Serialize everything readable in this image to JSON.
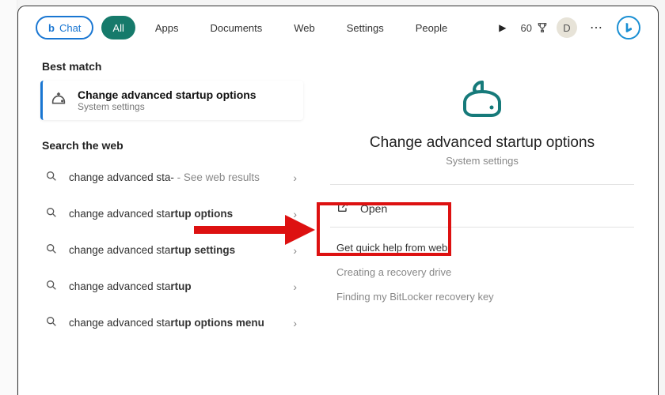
{
  "tabs": {
    "chat": "Chat",
    "all": "All",
    "apps": "Apps",
    "documents": "Documents",
    "web": "Web",
    "settings": "Settings",
    "people": "People",
    "rewards_count": "60",
    "avatar_initial": "D"
  },
  "left": {
    "best_match_heading": "Best match",
    "best": {
      "title": "Change advanced startup options",
      "subtitle": "System settings"
    },
    "search_web_heading": "Search the web",
    "results": [
      {
        "pre": "change advanced sta-",
        "post": "",
        "suffix": " - See web results"
      },
      {
        "pre": "change advanced sta",
        "post": "rtup options",
        "suffix": ""
      },
      {
        "pre": "change advanced sta",
        "post": "rtup settings",
        "suffix": ""
      },
      {
        "pre": "change advanced sta",
        "post": "rtup",
        "suffix": ""
      },
      {
        "pre": "change advanced sta",
        "post": "rtup options menu",
        "suffix": ""
      }
    ]
  },
  "right": {
    "title": "Change advanced startup options",
    "subtitle": "System settings",
    "open_label": "Open",
    "help_heading": "Get quick help from web",
    "help_links": [
      "Creating a recovery drive",
      "Finding my BitLocker recovery key"
    ]
  }
}
